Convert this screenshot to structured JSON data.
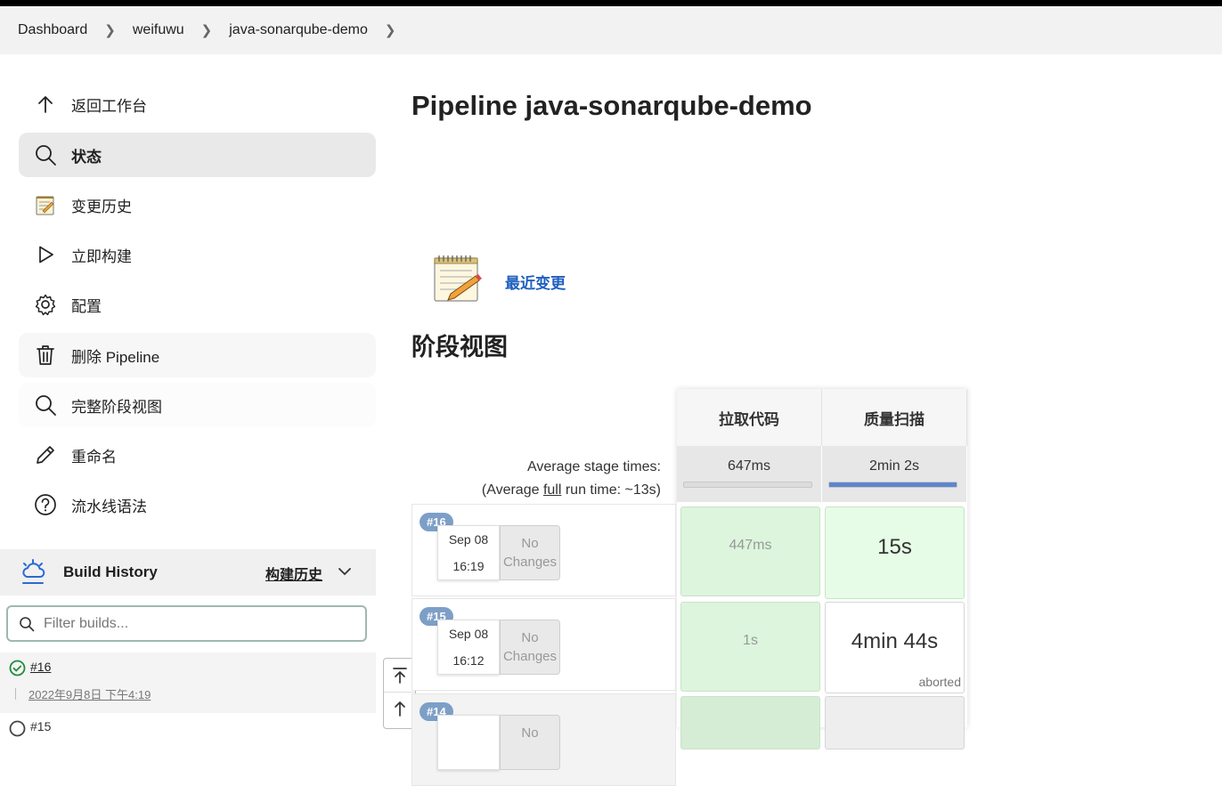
{
  "breadcrumb": [
    "Dashboard",
    "weifuwu",
    "java-sonarqube-demo"
  ],
  "sidebar": {
    "items": [
      {
        "label": "返回工作台",
        "icon": "arrow-up-icon"
      },
      {
        "label": "状态",
        "icon": "search-icon"
      },
      {
        "label": "变更历史",
        "icon": "notepad-icon"
      },
      {
        "label": "立即构建",
        "icon": "play-icon"
      },
      {
        "label": "配置",
        "icon": "gear-icon"
      },
      {
        "label": "删除 Pipeline",
        "icon": "trash-icon"
      },
      {
        "label": "完整阶段视图",
        "icon": "search-icon"
      },
      {
        "label": "重命名",
        "icon": "pencil-icon"
      },
      {
        "label": "流水线语法",
        "icon": "help-icon"
      }
    ]
  },
  "build_history": {
    "title": "Build History",
    "link": "构建历史",
    "filter_placeholder": "Filter builds...",
    "rows": [
      {
        "number": "#16",
        "date": "2022年9月8日 下午4:19",
        "status": "success"
      },
      {
        "number": "#15"
      }
    ]
  },
  "main": {
    "title": "Pipeline java-sonarqube-demo",
    "recent_changes": "最近变更",
    "stage_view_heading": "阶段视图"
  },
  "stage_view": {
    "stages": [
      "拉取代码",
      "质量扫描"
    ],
    "avg_label": "Average stage times:",
    "avg_full_prefix": "(Average ",
    "avg_full_link": "full",
    "avg_full_suffix": " run time: ~13s)",
    "avg_times": [
      "647ms",
      "2min 2s"
    ],
    "avg_progress": [
      0.0,
      1.0
    ],
    "runs": [
      {
        "badge": "#16",
        "date": "Sep 08",
        "time": "16:19",
        "changes_line1": "No",
        "changes_line2": "Changes",
        "cells": [
          "447ms",
          "15s"
        ],
        "notes": [
          "",
          ""
        ]
      },
      {
        "badge": "#15",
        "date": "Sep 08",
        "time": "16:12",
        "changes_line1": "No",
        "changes_line2": "Changes",
        "cells": [
          "1s",
          "4min 44s"
        ],
        "notes": [
          "",
          "aborted"
        ]
      },
      {
        "badge": "#14",
        "date": "",
        "time": "",
        "changes_line1": "No",
        "changes_line2": "",
        "cells": [
          "",
          ""
        ],
        "notes": [
          "",
          ""
        ]
      }
    ]
  },
  "colors": {
    "accent_link": "#1f5fbf",
    "success_cell": "#dcf5dc",
    "progress_fill": "#5d86cf",
    "badge": "#7d9fc7"
  }
}
